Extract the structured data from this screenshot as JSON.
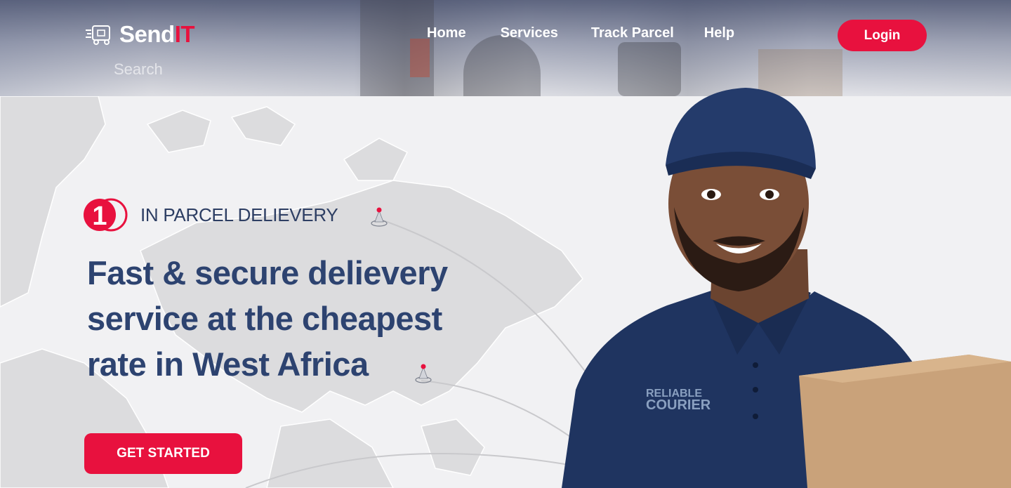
{
  "brand": {
    "name_main": "Send",
    "name_accent": "IT",
    "accent_color": "#e8113e",
    "text_color": "#2d4370"
  },
  "nav": {
    "items": [
      {
        "label": "Home"
      },
      {
        "label": "Services"
      },
      {
        "label": "Track Parcel"
      },
      {
        "label": "Help"
      }
    ],
    "login_label": "Login"
  },
  "search": {
    "placeholder": "Search"
  },
  "hero": {
    "badge_number": "1",
    "badge_text": "IN PARCEL DELIEVERY",
    "headline": "Fast & secure delievery service at the cheapest rate in West Africa",
    "cta_label": "GET STARTED"
  },
  "icons": {
    "logo": "delivery-truck-icon",
    "map_pin": "map-pin-icon"
  }
}
